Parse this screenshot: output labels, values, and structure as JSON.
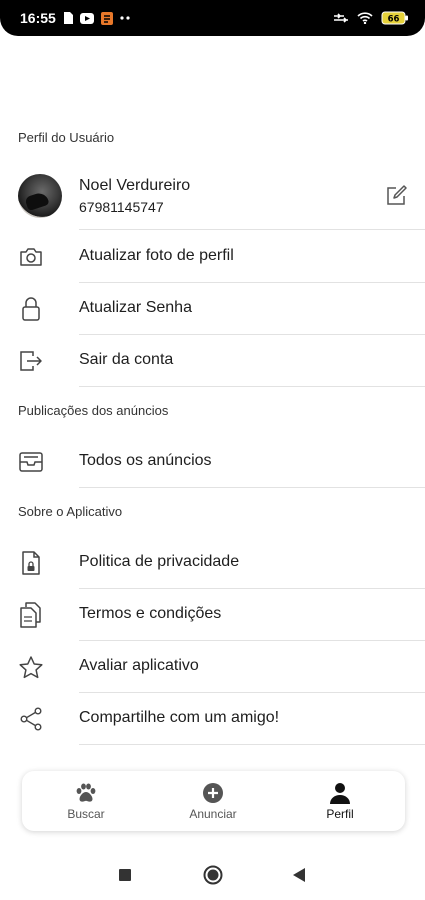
{
  "status_bar": {
    "time": "16:55",
    "battery_level": "66"
  },
  "sections": {
    "profile_header": "Perfil do Usuário",
    "ads_header": "Publicações dos anúncios",
    "about_header": "Sobre o Aplicativo"
  },
  "profile": {
    "name": "Noel Verdureiro",
    "phone": "67981145747"
  },
  "menu": {
    "update_photo": "Atualizar foto de perfil",
    "update_password": "Atualizar Senha",
    "logout": "Sair da conta",
    "all_ads": "Todos os anúncios",
    "privacy": "Politica de privacidade",
    "terms": "Termos e condições",
    "rate": "Avaliar aplicativo",
    "share": "Compartilhe com um amigo!"
  },
  "bottom_nav": {
    "items": [
      {
        "label": "Buscar",
        "icon": "paw-icon"
      },
      {
        "label": "Anunciar",
        "icon": "plus-circle-icon"
      },
      {
        "label": "Perfil",
        "icon": "person-icon",
        "active": true
      }
    ]
  },
  "colors": {
    "text": "#1e1e1e",
    "muted": "#555555",
    "active_nav": "#111111",
    "icon": "#444444"
  }
}
